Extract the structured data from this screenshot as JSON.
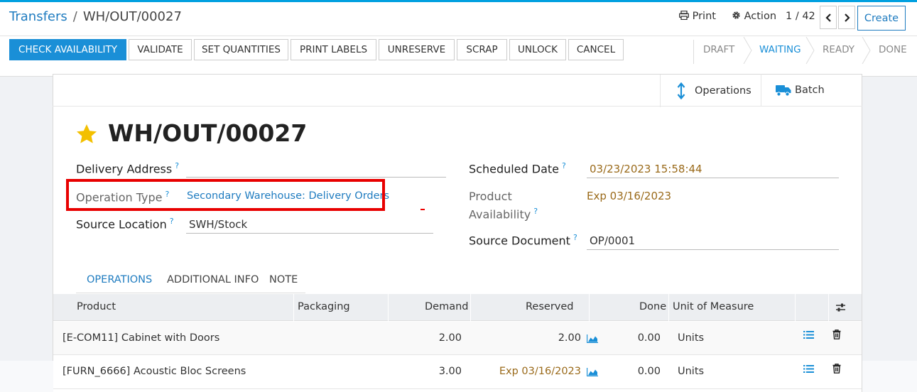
{
  "breadcrumb": {
    "parent": "Transfers",
    "separator": "/",
    "current": "WH/OUT/00027"
  },
  "header_actions": {
    "print": "Print",
    "action": "Action",
    "pager": "1 / 42",
    "create": "Create"
  },
  "toolbar": {
    "buttons": [
      "CHECK AVAILABILITY",
      "VALIDATE",
      "SET QUANTITIES",
      "PRINT LABELS",
      "UNRESERVE",
      "SCRAP",
      "UNLOCK",
      "CANCEL"
    ]
  },
  "statusbar": {
    "stages": [
      "DRAFT",
      "WAITING",
      "READY",
      "DONE"
    ],
    "active": "WAITING"
  },
  "smart_buttons": {
    "operations": "Operations",
    "batch": "Batch"
  },
  "record": {
    "title": "WH/OUT/00027",
    "help_mark": "?",
    "delivery_address_label": "Delivery Address",
    "operation_type_label": "Operation Type",
    "operation_type_value": "Secondary Warehouse: Delivery Orders",
    "source_location_label": "Source Location",
    "source_location_value": "SWH/Stock",
    "scheduled_date_label": "Scheduled Date",
    "scheduled_date_value": "03/23/2023 15:58:44",
    "product_availability_label_1": "Product",
    "product_availability_label_2": "Availability",
    "product_availability_value": "Exp 03/16/2023",
    "source_document_label": "Source Document",
    "source_document_value": "OP/0001"
  },
  "tabs": [
    "OPERATIONS",
    "ADDITIONAL INFO",
    "NOTE"
  ],
  "table": {
    "columns": [
      "Product",
      "Packaging",
      "Demand",
      "Reserved",
      "Done",
      "Unit of Measure"
    ],
    "rows": [
      {
        "product": "[E-COM11] Cabinet with Doors",
        "packaging": "",
        "demand": "2.00",
        "reserved": "2.00",
        "done": "0.00",
        "uom": "Units"
      },
      {
        "product": "[FURN_6666] Acoustic Bloc Screens",
        "packaging": "",
        "demand": "3.00",
        "reserved": "Exp 03/16/2023",
        "done": "0.00",
        "uom": "Units"
      }
    ]
  },
  "colors": {
    "accent": "#1a8fd7",
    "link": "#1f7cc0",
    "warning": "#9a6a1a",
    "highlight": "#e80000",
    "star": "#f3c000"
  }
}
